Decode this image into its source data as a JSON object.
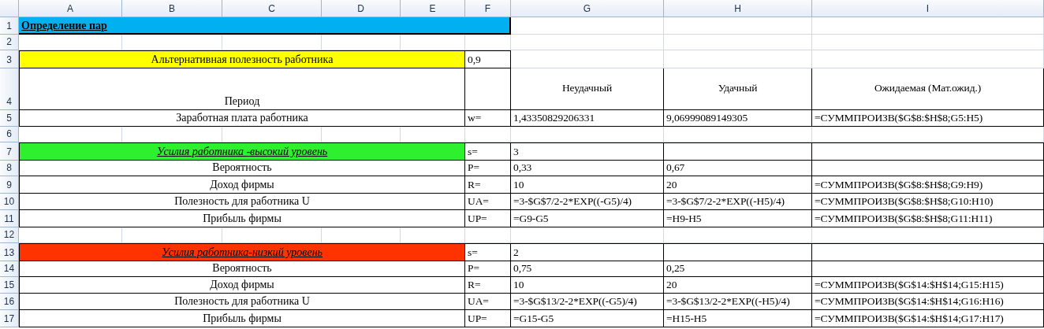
{
  "columns": [
    "A",
    "B",
    "C",
    "D",
    "E",
    "F",
    "G",
    "H",
    "I"
  ],
  "rows": [
    {
      "num": "1",
      "kind": "title",
      "label": "Определение пар",
      "color": "#00b0f0"
    },
    {
      "num": "2",
      "kind": "blank"
    },
    {
      "num": "3",
      "kind": "param",
      "label": "Альтернативная полезность работника",
      "color": "#ffff00",
      "f": "0,9"
    },
    {
      "num": "4",
      "kind": "header",
      "label": "Период",
      "g": "Неудачный",
      "h": "Удачный",
      "i": "Ожидаемая (Мат.ожид.)"
    },
    {
      "num": "5",
      "kind": "data",
      "label": "Заработная плата работника",
      "f": "w=",
      "g": "1,43350829206331",
      "h": "9,06999089149305",
      "i": "=СУММПРОИЗВ($G$8:$H$8;G5:H5)"
    },
    {
      "num": "6",
      "kind": "blank"
    },
    {
      "num": "7",
      "kind": "section",
      "label": "Усилия работника -высокий уровень",
      "color": "#2ef02e",
      "f": "s=",
      "g": "3"
    },
    {
      "num": "8",
      "kind": "data",
      "label": "Вероятность",
      "f": "P=",
      "g": "0,33",
      "h": "0,67"
    },
    {
      "num": "9",
      "kind": "data",
      "label": "Доход фирмы",
      "f": "R=",
      "g": "10",
      "h": "20",
      "i": "=СУММПРОИЗВ($G$8:$H$8;G9:H9)"
    },
    {
      "num": "10",
      "kind": "data",
      "label": "Полезность для работника U",
      "f": "UA=",
      "g": "=3-$G$7/2-2*EXP((-G5)/4)",
      "h": "=3-$G$7/2-2*EXP((-H5)/4)",
      "i": "=СУММПРОИЗВ($G$8:$H$8;G10:H10)"
    },
    {
      "num": "11",
      "kind": "data",
      "label": "Прибыль фирмы",
      "f": "UP=",
      "g": "=G9-G5",
      "h": "=H9-H5",
      "i": "=СУММПРОИЗВ($G$8:$H$8;G11:H11)"
    },
    {
      "num": "12",
      "kind": "blank"
    },
    {
      "num": "13",
      "kind": "section",
      "label": "Усилия работника-низкий уровень ",
      "color": "#ff3300",
      "f": "s=",
      "g": "2"
    },
    {
      "num": "14",
      "kind": "data",
      "label": "Вероятность",
      "f": "P=",
      "g": "0,75",
      "h": "0,25"
    },
    {
      "num": "15",
      "kind": "data",
      "label": "Доход фирмы",
      "f": "R=",
      "g": "10",
      "h": "20",
      "i": "=СУММПРОИЗВ($G$14:$H$14;G15:H15)"
    },
    {
      "num": "16",
      "kind": "data",
      "label": "Полезность для работника U",
      "f": "UA=",
      "g": "=3-$G$13/2-2*EXP((-G5)/4)",
      "h": "=3-$G$13/2-2*EXP((-H5)/4)",
      "i": "=СУММПРОИЗВ($G$14:$H$14;G16:H16)"
    },
    {
      "num": "17",
      "kind": "data",
      "label": "Прибыль фирмы",
      "f": "UP=",
      "g": "=G15-G5",
      "h": "=H15-H5",
      "i": "=СУММПРОИЗВ($G$14:$H$14;G17:H17)"
    }
  ]
}
